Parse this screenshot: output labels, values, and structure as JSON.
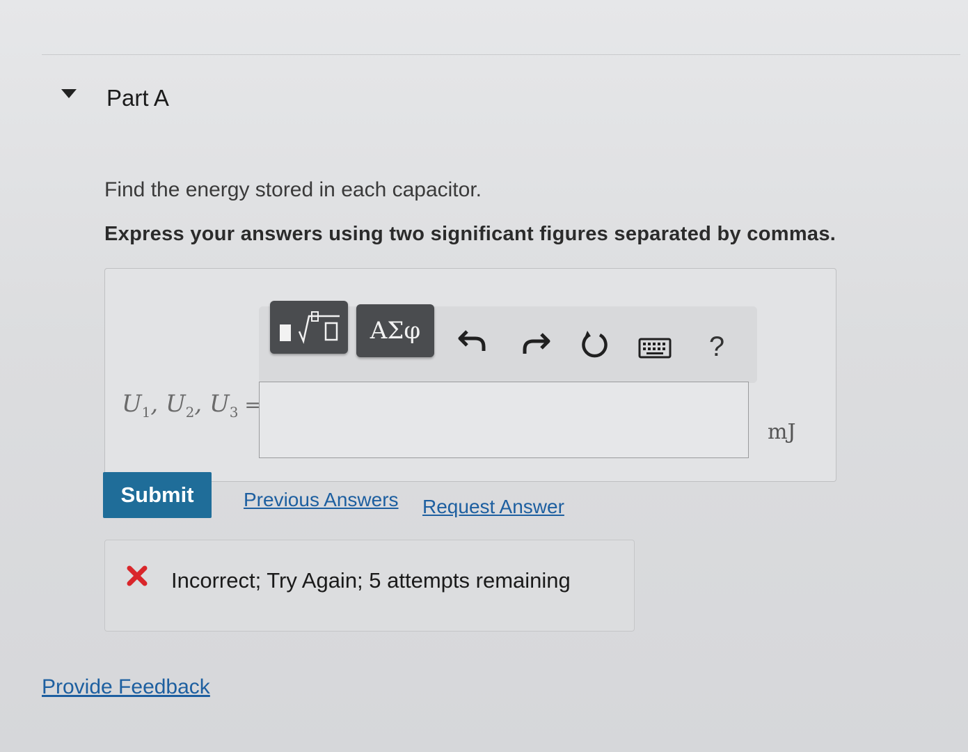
{
  "part": {
    "title": "Part A"
  },
  "question": {
    "prompt": "Find the energy stored in each capacitor.",
    "instructions": "Express your answers using two significant figures separated by commas."
  },
  "toolbar": {
    "templates_icon": "templates-sqrt-icon",
    "symbols_label": "ΑΣφ",
    "undo_icon": "undo-icon",
    "redo_icon": "redo-icon",
    "reset_icon": "reset-icon",
    "keyboard_icon": "keyboard-icon",
    "help_label": "?"
  },
  "answer": {
    "variables": [
      "U",
      "1",
      "U",
      "2",
      "U",
      "3"
    ],
    "label_text": "U1, U2, U3 =",
    "value": "",
    "placeholder": "",
    "unit": "mJ"
  },
  "actions": {
    "submit_label": "Submit",
    "previous_answers_label": "Previous Answers",
    "request_answer_label": "Request Answer"
  },
  "feedback": {
    "status_icon": "x-icon",
    "status_color": "#d9262b",
    "message": "Incorrect; Try Again; 5 attempts remaining"
  },
  "footer": {
    "provide_feedback_label": "Provide Feedback"
  },
  "colors": {
    "submit_bg": "#1f6d99",
    "link": "#1d5fa0",
    "toolbar_button": "#4a4c4f"
  }
}
